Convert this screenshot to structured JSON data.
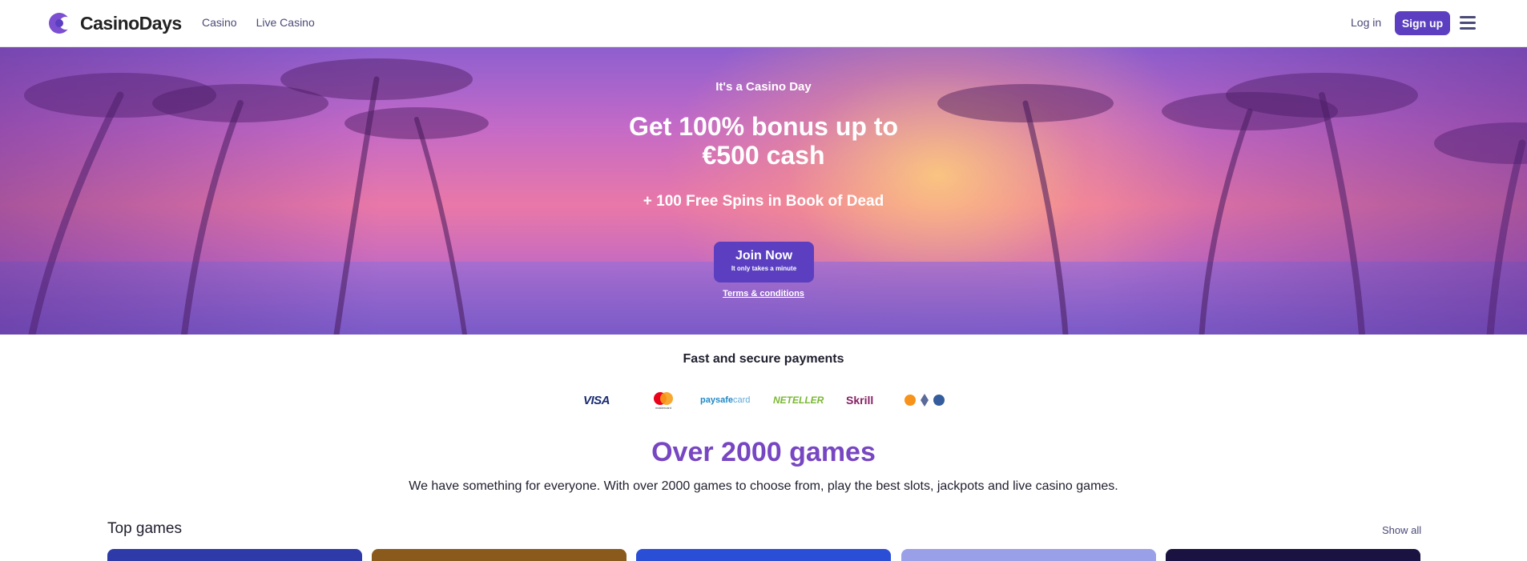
{
  "header": {
    "brand": "CasinoDays",
    "nav": [
      "Casino",
      "Live Casino"
    ],
    "login_label": "Log in",
    "signup_label": "Sign up",
    "brand_color": "#5b3fc0"
  },
  "hero": {
    "kicker": "It's a Casino Day",
    "title": "Get 100% bonus up to €500 cash",
    "subtitle": "+ 100 Free Spins in Book of Dead",
    "cta_label": "Join Now",
    "cta_sublabel": "It only takes a minute",
    "terms_label": "Terms & conditions"
  },
  "payments": {
    "title": "Fast and secure payments",
    "visa": "VISA",
    "mastercard_caption": "mastercard",
    "paysafe": "paysafe",
    "paysafe_suffix": "card",
    "neteller": "NETELLER",
    "skrill": "Skrill",
    "methods_icons": [
      "visa-logo",
      "mastercard-logo",
      "paysafecard-logo",
      "neteller-logo",
      "skrill-logo",
      "crypto-logos"
    ]
  },
  "games": {
    "title": "Over 2000 games",
    "description": "We have something for everyone. With over 2000 games to choose from, play the best slots, jackpots and live casino games.",
    "section_title": "Top games",
    "show_all_label": "Show all",
    "tile_colors": [
      "#2e3aa8",
      "#8a5a1c",
      "#2a4fd6",
      "#9aa0e8",
      "#1a1240"
    ]
  }
}
